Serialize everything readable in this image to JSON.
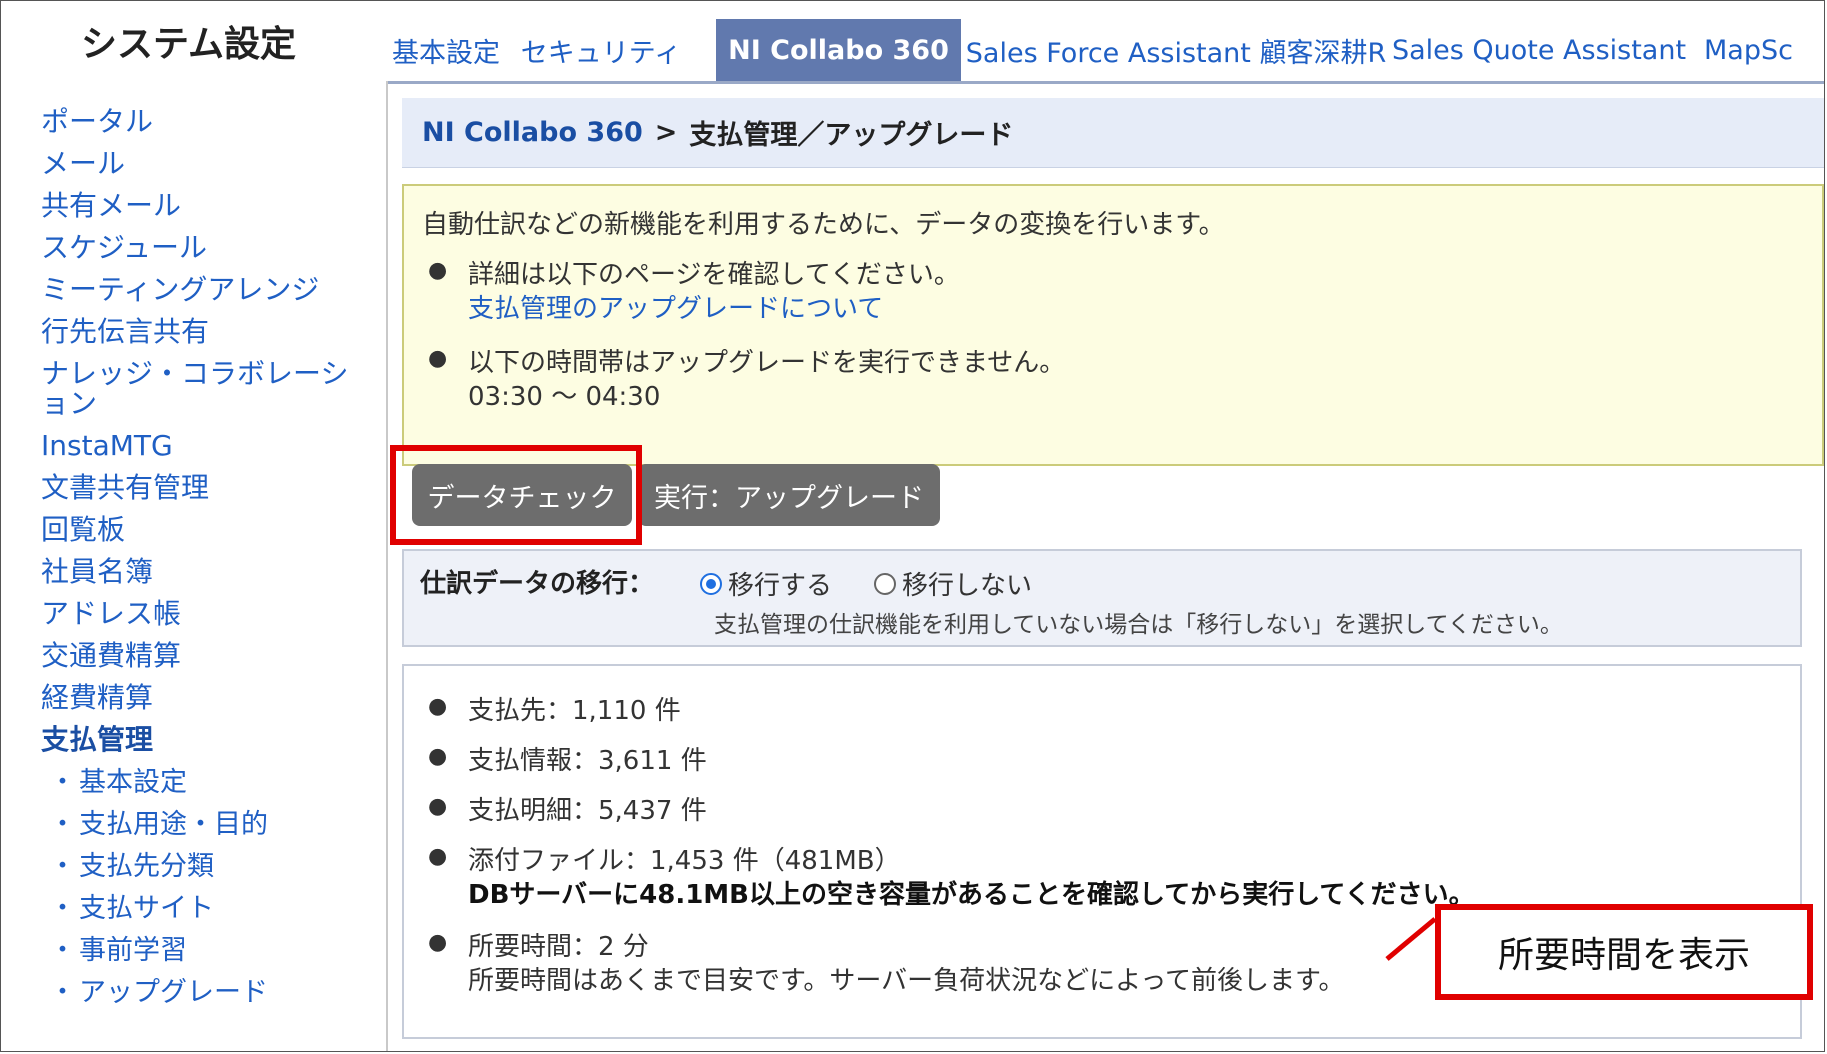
{
  "app": {
    "title": "システム設定"
  },
  "tabs": [
    {
      "label": "基本設定"
    },
    {
      "label": "セキュリティ"
    },
    {
      "label": "NI Collabo 360"
    },
    {
      "label": "Sales Force Assistant 顧客深耕R"
    },
    {
      "label": "Sales Quote Assistant"
    },
    {
      "label": "MapSc"
    }
  ],
  "sidebar": {
    "items": [
      {
        "label": "ポータル"
      },
      {
        "label": "メール"
      },
      {
        "label": "共有メール"
      },
      {
        "label": "スケジュール"
      },
      {
        "label": "ミーティングアレンジ"
      },
      {
        "label": "行先伝言共有"
      },
      {
        "label": "ナレッジ・コラボレーシ"
      },
      {
        "label": "ョン"
      },
      {
        "label": "InstaMTG"
      },
      {
        "label": "文書共有管理"
      },
      {
        "label": "回覧板"
      },
      {
        "label": "社員名簿"
      },
      {
        "label": "アドレス帳"
      },
      {
        "label": "交通費精算"
      },
      {
        "label": "経費精算"
      },
      {
        "label": "支払管理"
      }
    ],
    "sub_items": [
      {
        "label": "基本設定"
      },
      {
        "label": "支払用途・目的"
      },
      {
        "label": "支払先分類"
      },
      {
        "label": "支払サイト"
      },
      {
        "label": "事前学習"
      },
      {
        "label": "アップグレード"
      }
    ],
    "bullet": "・"
  },
  "breadcrumb": {
    "parent": "NI Collabo 360",
    "separator": ">",
    "current": "支払管理／アップグレード"
  },
  "notice": {
    "lead": "自動仕訳などの新機能を利用するために、データの変換を行います。",
    "item1_text": "詳細は以下のページを確認してください。",
    "item1_link": "支払管理のアップグレードについて",
    "item2_text": "以下の時間帯はアップグレードを実行できません。",
    "item2_time": "03:30 ～ 04:30"
  },
  "buttons": {
    "data_check": "データチェック",
    "execute_upgrade": "実行：アップグレード"
  },
  "migration": {
    "label": "仕訳データの移行：",
    "option_yes": "移行する",
    "option_no": "移行しない",
    "selected": "移行する",
    "note": "支払管理の仕訳機能を利用していない場合は「移行しない」を選択してください。"
  },
  "stats": {
    "payees": "支払先：1,110 件",
    "payment_info": "支払情報：3,611 件",
    "payment_details": "支払明細：5,437 件",
    "attachments": "添付ファイル：1,453 件（481MB）",
    "db_warning": "DBサーバーに48.1MB以上の空き容量があることを確認してから実行してください。",
    "required_time": "所要時間：2 分",
    "time_note": "所要時間はあくまで目安です。サーバー負荷状況などによって前後します。"
  },
  "callout": {
    "text": "所要時間を表示"
  },
  "colors": {
    "accent": "#6179ae",
    "link": "#1f5fc4",
    "highlight": "#e00000",
    "notice_bg": "#fdfde2"
  },
  "bullet_glyph": "●"
}
